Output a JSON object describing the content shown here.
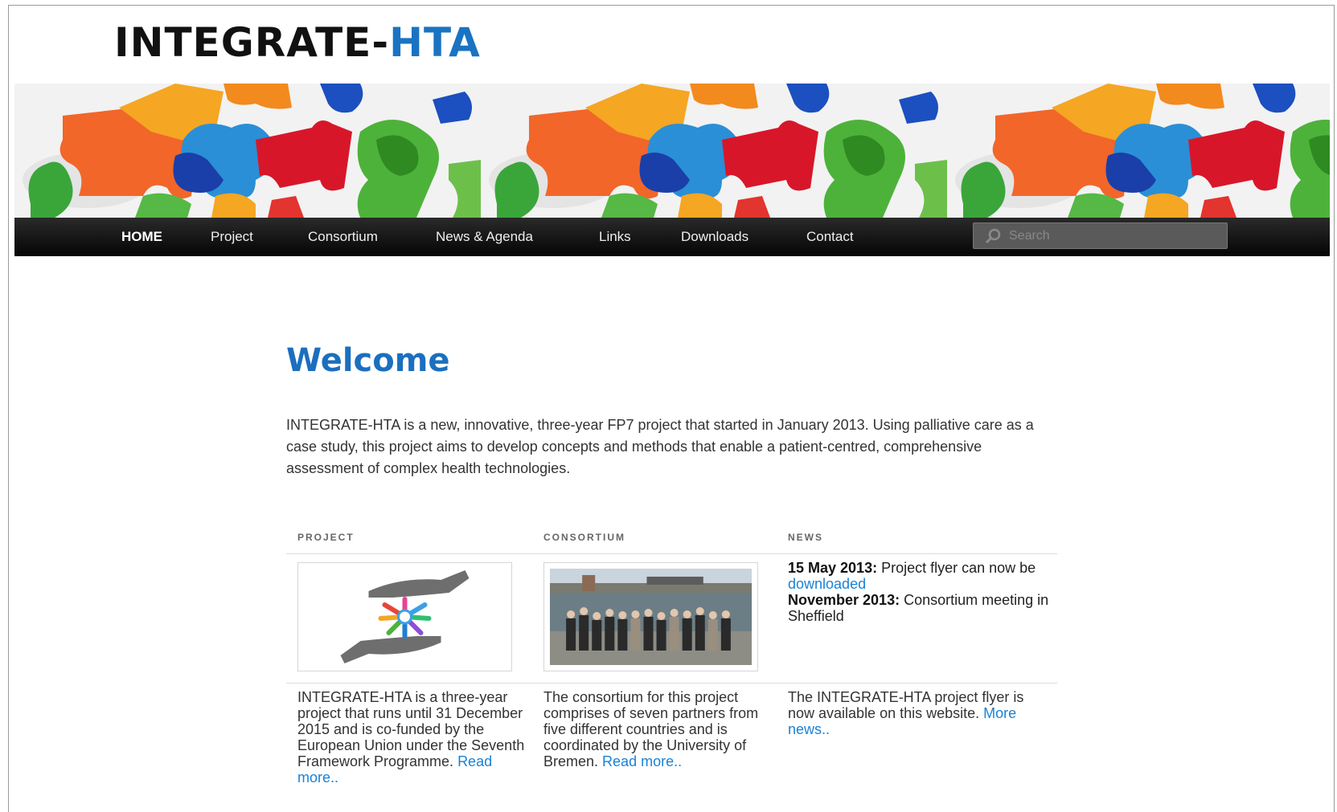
{
  "header": {
    "title_main": "INTEGRATE-",
    "title_accent": "HTA"
  },
  "nav": {
    "items": [
      {
        "label": "HOME"
      },
      {
        "label": "Project"
      },
      {
        "label": "Consortium"
      },
      {
        "label": "News & Agenda"
      },
      {
        "label": "Links"
      },
      {
        "label": "Downloads"
      },
      {
        "label": "Contact"
      }
    ],
    "search_placeholder": "Search"
  },
  "main": {
    "title": "Welcome",
    "intro": "INTEGRATE-HTA is a new, innovative, three-year FP7 project that started in January 2013. Using palliative care as a case study, this project aims to develop concepts and methods that enable a patient-centred, comprehensive assessment of complex health technologies.",
    "columns": {
      "project": {
        "header": "PROJECT",
        "text": "INTEGRATE-HTA is a three-year project that runs until 31 December 2015 and is co-funded by the European Union under the Seventh Framework Programme.",
        "link": "Read more.."
      },
      "consortium": {
        "header": "CONSORTIUM",
        "text": "The consortium for this project comprises of seven partners from five different countries and is coordinated by the University of Bremen.",
        "link": "Read more.."
      },
      "news": {
        "header": "NEWS",
        "item1_date": "15 May 2013:",
        "item1_text": "Project flyer can now be",
        "item1_link": "downloaded",
        "item2_date": "November 2013:",
        "item2_text": "Consortium meeting in Sheffield",
        "text": "The INTEGRATE-HTA project flyer is now available on this website.",
        "link": "More news.."
      }
    }
  },
  "colors": {
    "accent": "#1b6fbe",
    "link": "#1b82d6",
    "nav_bg": "#111111"
  }
}
